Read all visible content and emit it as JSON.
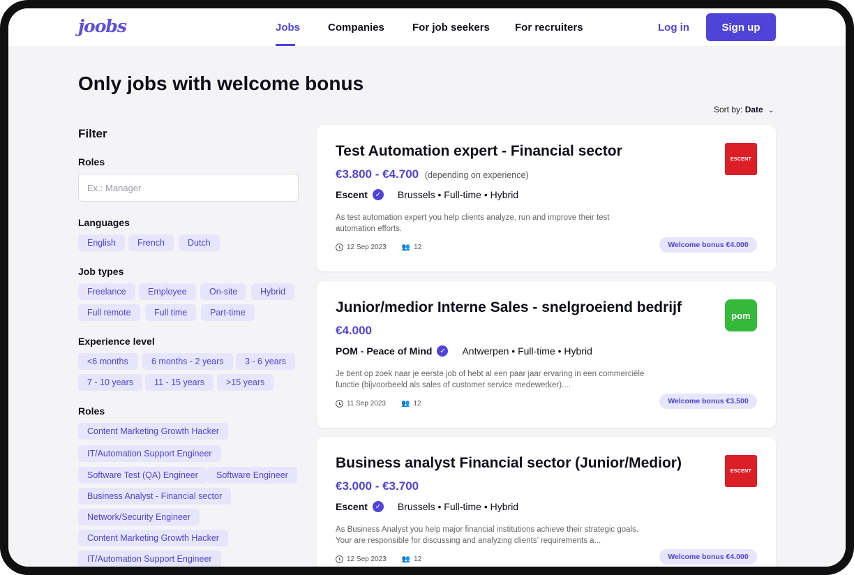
{
  "header": {
    "logo": "joobs",
    "nav": [
      "Jobs",
      "Companies",
      "For job seekers",
      "For recruiters"
    ],
    "active_nav": "Jobs",
    "login": "Log in",
    "signup": "Sign up",
    "accent_color": "#4f44d8"
  },
  "page": {
    "title": "Only jobs with welcome bonus",
    "sort_label": "Sort by:",
    "sort_value": "Date"
  },
  "filter": {
    "title": "Filter",
    "roles_label": "Roles",
    "roles_placeholder": "Ex.: Manager",
    "languages_label": "Languages",
    "languages": [
      "English",
      "French",
      "Dutch"
    ],
    "job_types_label": "Job types",
    "job_types": [
      "Freelance",
      "Employee",
      "On-site",
      "Hybrid",
      "Full remote",
      "Full time",
      "Part-time"
    ],
    "experience_label": "Experience level",
    "experience": [
      "<6 months",
      "6 months - 2 years",
      "3 - 6 years",
      "7 - 10 years",
      "11 - 15 years",
      ">15 years"
    ],
    "roles_list_label": "Roles",
    "roles_list": [
      "Content Marketing Growth Hacker",
      "IT/Automation Support Engineer",
      "Software Test (QA) Engineer",
      "Software Engineer",
      "Business Analyst - Financial sector",
      "Network/Security Engineer",
      "Content Marketing Growth Hacker",
      "IT/Automation Support Engineer"
    ]
  },
  "jobs": [
    {
      "title": "Test Automation expert - Financial sector",
      "salary": "€3.800 - €4.700",
      "salary_note": "(depending on experience)",
      "company": "Escent",
      "meta": "Brussels • Full-time • Hybrid",
      "description": "As test automation expert you help clients analyze, run and improve their test automation efforts.",
      "date": "12 Sep 2023",
      "applicants": "12",
      "bonus": "Welcome bonus €4.000",
      "logo_text": "ESCENT",
      "logo_color": "#dc1f26"
    },
    {
      "title": "Junior/medior Interne Sales - snelgroeiend bedrijf",
      "salary": "€4.000",
      "salary_note": "",
      "company": "POM - Peace of Mind",
      "meta": "Antwerpen • Full-time • Hybrid",
      "description": "Je bent op zoek naar je eerste job of hebt al een paar jaar ervaring in een commerciële functie (bijvoorbeeld als sales of customer service medewerker)....",
      "date": "11 Sep 2023",
      "applicants": "12",
      "bonus": "Welcome bonus €3.500",
      "logo_text": "pom",
      "logo_color": "#35b93b"
    },
    {
      "title": "Business analyst Financial sector (Junior/Medior)",
      "salary": "€3.000 - €3.700",
      "salary_note": "",
      "company": "Escent",
      "meta": "Brussels • Full-time • Hybrid",
      "description": "As Business Analyst you help major financial institutions achieve their strategic goals. Your are responsible for discussing and analyzing clients’ requirements a...",
      "date": "12 Sep 2023",
      "applicants": "12",
      "bonus": "Welcome bonus €4.000",
      "logo_text": "ESCENT",
      "logo_color": "#dc1f26"
    }
  ]
}
